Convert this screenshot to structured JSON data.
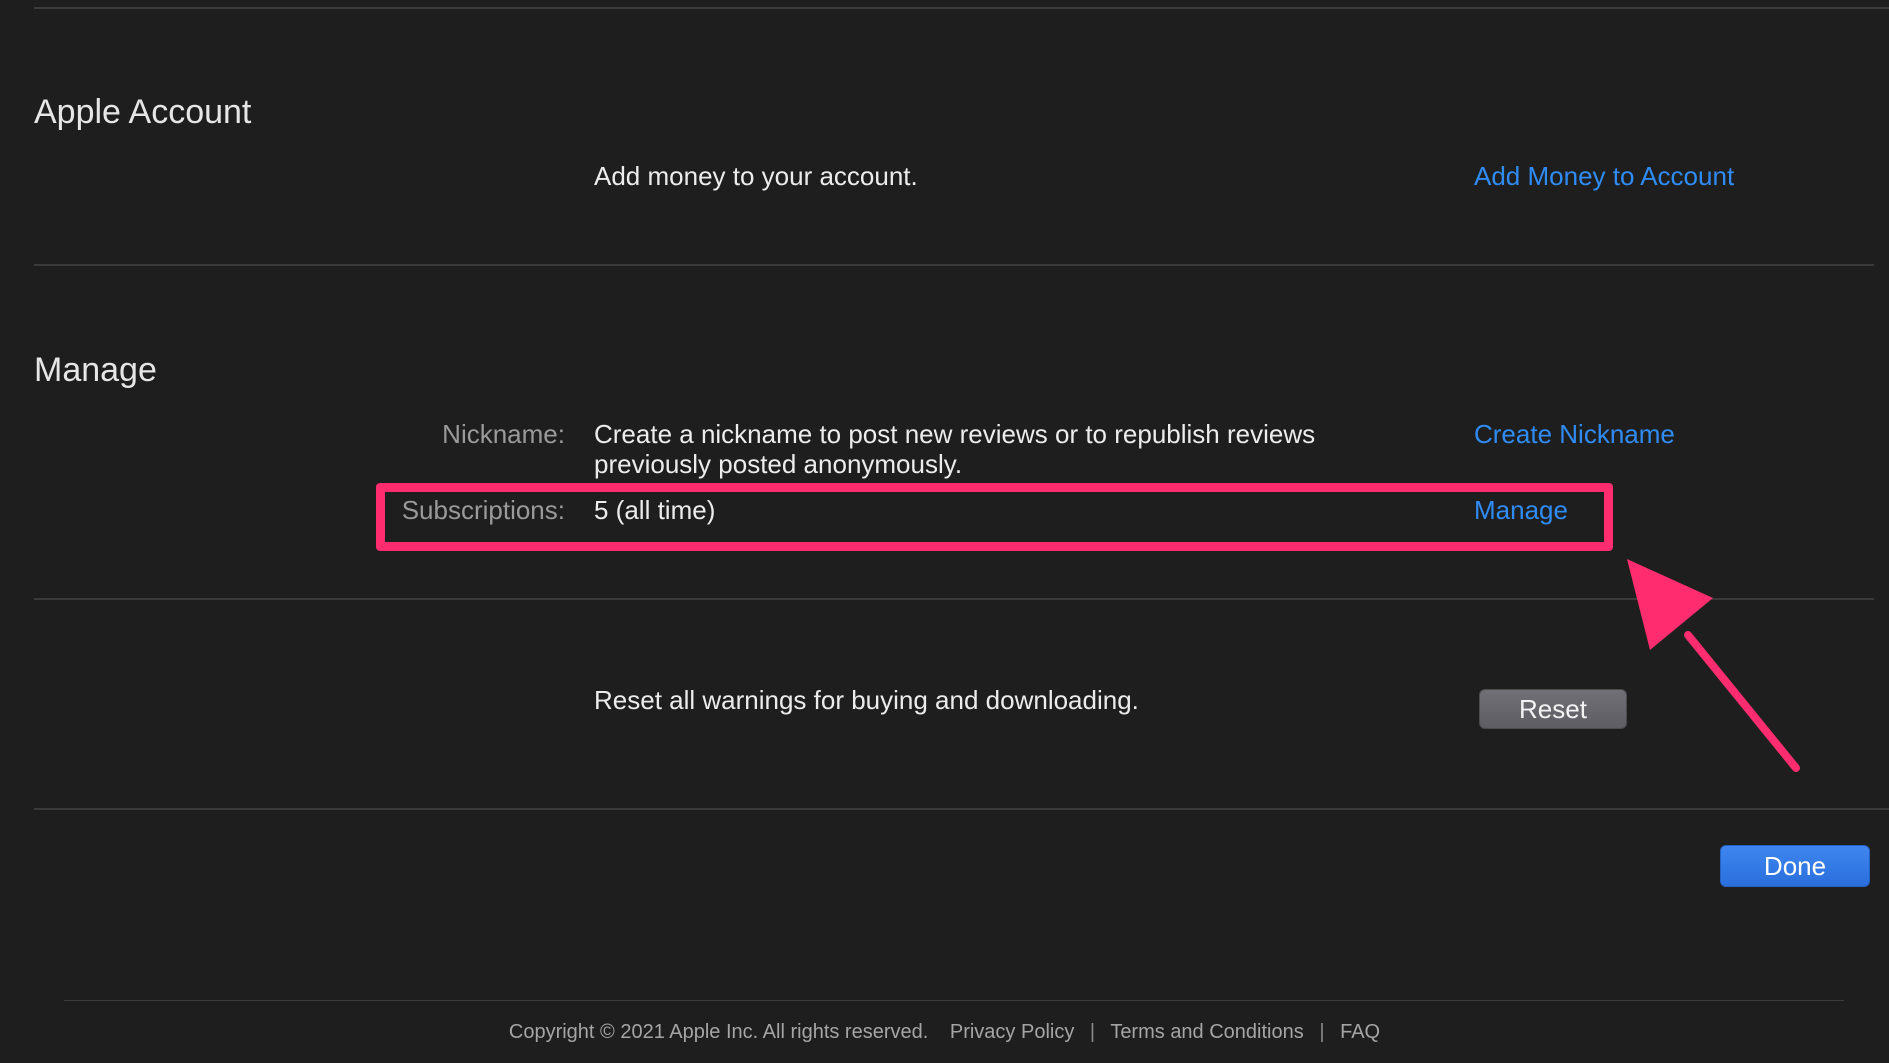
{
  "apple_account": {
    "title": "Apple Account",
    "description": "Add money to your account.",
    "action_label": "Add Money to Account"
  },
  "manage": {
    "title": "Manage",
    "nickname_label": "Nickname:",
    "nickname_description_line1": "Create a nickname to post new reviews or to republish reviews",
    "nickname_description_line2": "previously posted anonymously.",
    "nickname_action_label": "Create Nickname",
    "subscriptions_label": "Subscriptions:",
    "subscriptions_value": "5 (all time)",
    "subscriptions_action_label": "Manage"
  },
  "warnings": {
    "description": "Reset all warnings for buying and downloading.",
    "reset_label": "Reset"
  },
  "done_label": "Done",
  "footer": {
    "copyright": "Copyright © 2021 Apple Inc. All rights reserved.",
    "links": [
      "Privacy Policy",
      "Terms and Conditions",
      "FAQ"
    ],
    "separator": "|"
  },
  "annotation": {
    "highlight_color": "#ff2d6f"
  },
  "colors": {
    "background": "#1e1e1e",
    "link": "#2f8cf5",
    "done_button": "#2a6fdc"
  }
}
